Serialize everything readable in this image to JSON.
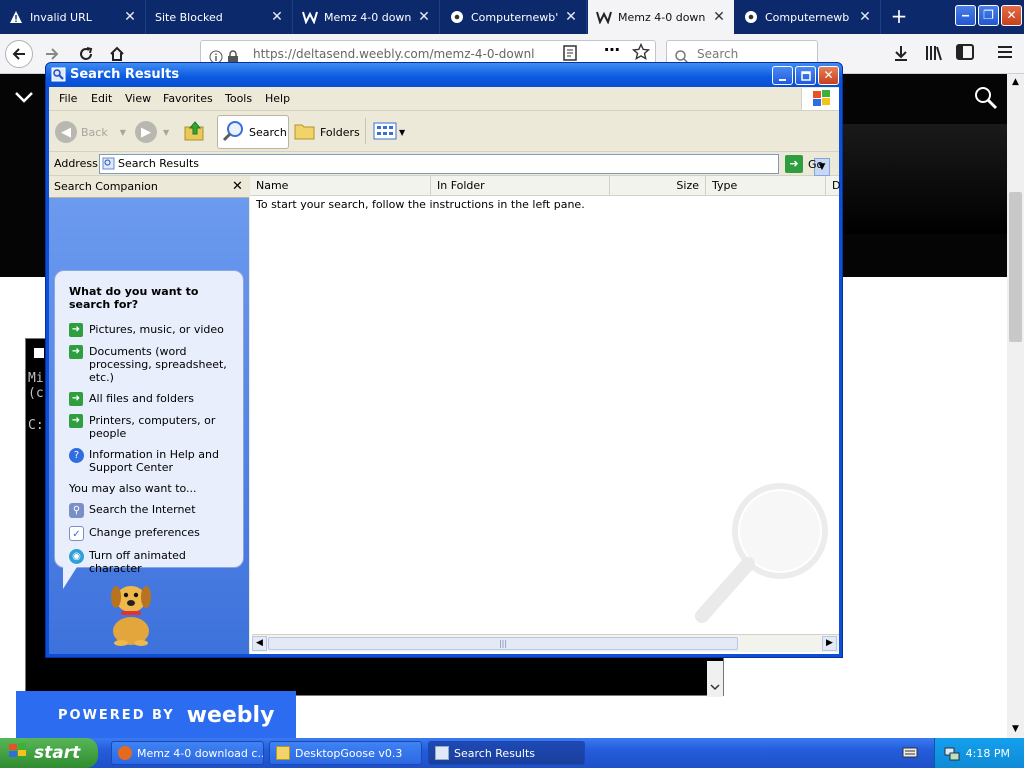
{
  "browser": {
    "tabs": [
      {
        "label": "Invalid URL",
        "icon": "warning-icon"
      },
      {
        "label": "Site Blocked",
        "icon": ""
      },
      {
        "label": "Memz 4-0 downlo",
        "icon": "weebly-w-icon"
      },
      {
        "label": "Computernewb's",
        "icon": "soccer-ball-icon"
      },
      {
        "label": "Memz 4-0 downlo",
        "icon": "weebly-w-icon"
      },
      {
        "label": "Computernewb W",
        "icon": "soccer-ball-icon"
      }
    ],
    "new_tab_label": "+",
    "url": "https://deltasend.weebly.com/memz-4-0-downl",
    "search_placeholder": "Search",
    "minimize_glyph": "‒",
    "restore_glyph": "❐",
    "close_glyph": "✕"
  },
  "webpage": {
    "cmd_lines": [
      "Mi",
      "(c",
      "C:"
    ],
    "weebly_powered": "POWERED BY",
    "weebly_brand": "weebly"
  },
  "xp_window": {
    "title": "Search Results",
    "menu": [
      "File",
      "Edit",
      "View",
      "Favorites",
      "Tools",
      "Help"
    ],
    "toolbar": {
      "back": "Back",
      "search": "Search",
      "folders": "Folders"
    },
    "address_label": "Address",
    "address_value": "Search Results",
    "go_label": "Go",
    "companion_title": "Search Companion",
    "question": "What do you want to search for?",
    "search_options": [
      "Pictures, music, or video",
      "Documents (word processing, spreadsheet, etc.)",
      "All files and folders",
      "Printers, computers, or people"
    ],
    "help_option": "Information in Help and Support Center",
    "also_label": "You may also want to...",
    "also_options": [
      "Search the Internet",
      "Change preferences",
      "Turn off animated character"
    ],
    "columns": [
      "Name",
      "In Folder",
      "Size",
      "Type",
      "D"
    ],
    "hint": "To start your search, follow the instructions in the left pane."
  },
  "taskbar": {
    "start": "start",
    "items": [
      {
        "label": "Memz 4-0 download c...",
        "icon": "firefox-icon"
      },
      {
        "label": "DesktopGoose v0.3",
        "icon": "folder-icon"
      },
      {
        "label": "Search Results",
        "icon": "search-window-icon"
      }
    ],
    "clock": "4:18 PM"
  },
  "colors": {
    "xp_blue": "#0a59e0",
    "start_green": "#3c9c3c",
    "weebly_blue": "#2b6cf0"
  }
}
